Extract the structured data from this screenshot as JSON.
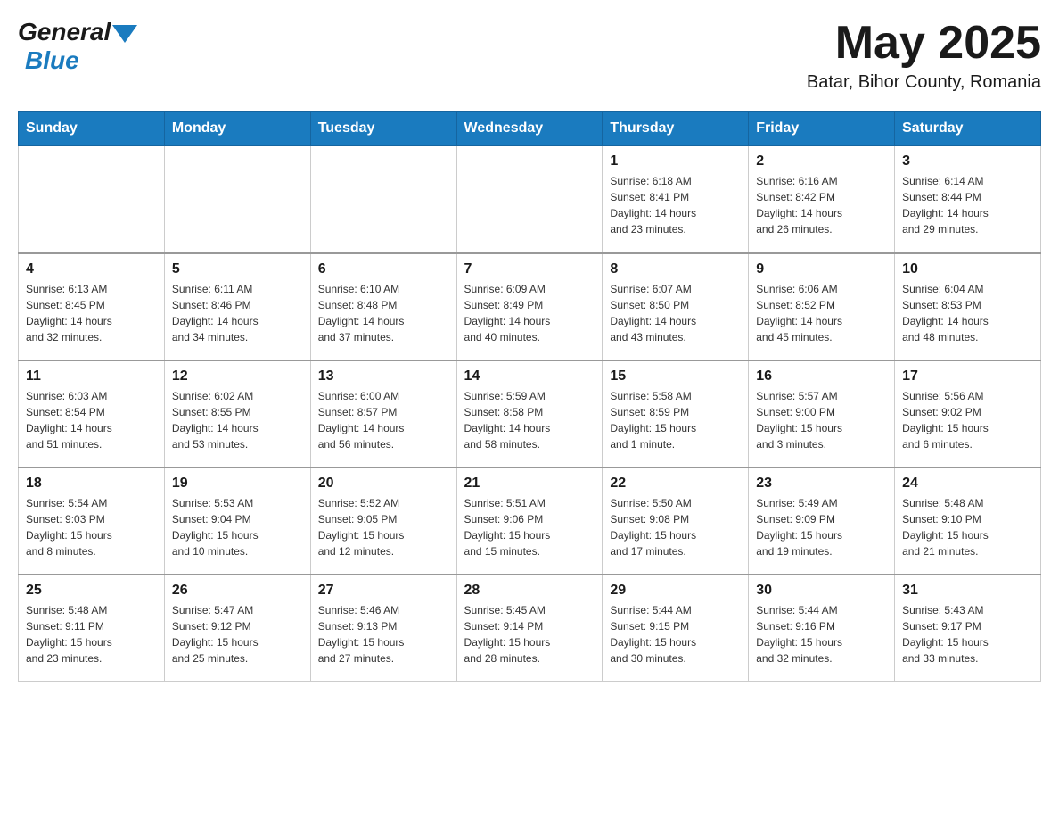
{
  "logo": {
    "general": "General",
    "blue": "Blue"
  },
  "header": {
    "month_title": "May 2025",
    "location": "Batar, Bihor County, Romania"
  },
  "days_of_week": [
    "Sunday",
    "Monday",
    "Tuesday",
    "Wednesday",
    "Thursday",
    "Friday",
    "Saturday"
  ],
  "weeks": [
    [
      {
        "day": "",
        "info": ""
      },
      {
        "day": "",
        "info": ""
      },
      {
        "day": "",
        "info": ""
      },
      {
        "day": "",
        "info": ""
      },
      {
        "day": "1",
        "info": "Sunrise: 6:18 AM\nSunset: 8:41 PM\nDaylight: 14 hours\nand 23 minutes."
      },
      {
        "day": "2",
        "info": "Sunrise: 6:16 AM\nSunset: 8:42 PM\nDaylight: 14 hours\nand 26 minutes."
      },
      {
        "day": "3",
        "info": "Sunrise: 6:14 AM\nSunset: 8:44 PM\nDaylight: 14 hours\nand 29 minutes."
      }
    ],
    [
      {
        "day": "4",
        "info": "Sunrise: 6:13 AM\nSunset: 8:45 PM\nDaylight: 14 hours\nand 32 minutes."
      },
      {
        "day": "5",
        "info": "Sunrise: 6:11 AM\nSunset: 8:46 PM\nDaylight: 14 hours\nand 34 minutes."
      },
      {
        "day": "6",
        "info": "Sunrise: 6:10 AM\nSunset: 8:48 PM\nDaylight: 14 hours\nand 37 minutes."
      },
      {
        "day": "7",
        "info": "Sunrise: 6:09 AM\nSunset: 8:49 PM\nDaylight: 14 hours\nand 40 minutes."
      },
      {
        "day": "8",
        "info": "Sunrise: 6:07 AM\nSunset: 8:50 PM\nDaylight: 14 hours\nand 43 minutes."
      },
      {
        "day": "9",
        "info": "Sunrise: 6:06 AM\nSunset: 8:52 PM\nDaylight: 14 hours\nand 45 minutes."
      },
      {
        "day": "10",
        "info": "Sunrise: 6:04 AM\nSunset: 8:53 PM\nDaylight: 14 hours\nand 48 minutes."
      }
    ],
    [
      {
        "day": "11",
        "info": "Sunrise: 6:03 AM\nSunset: 8:54 PM\nDaylight: 14 hours\nand 51 minutes."
      },
      {
        "day": "12",
        "info": "Sunrise: 6:02 AM\nSunset: 8:55 PM\nDaylight: 14 hours\nand 53 minutes."
      },
      {
        "day": "13",
        "info": "Sunrise: 6:00 AM\nSunset: 8:57 PM\nDaylight: 14 hours\nand 56 minutes."
      },
      {
        "day": "14",
        "info": "Sunrise: 5:59 AM\nSunset: 8:58 PM\nDaylight: 14 hours\nand 58 minutes."
      },
      {
        "day": "15",
        "info": "Sunrise: 5:58 AM\nSunset: 8:59 PM\nDaylight: 15 hours\nand 1 minute."
      },
      {
        "day": "16",
        "info": "Sunrise: 5:57 AM\nSunset: 9:00 PM\nDaylight: 15 hours\nand 3 minutes."
      },
      {
        "day": "17",
        "info": "Sunrise: 5:56 AM\nSunset: 9:02 PM\nDaylight: 15 hours\nand 6 minutes."
      }
    ],
    [
      {
        "day": "18",
        "info": "Sunrise: 5:54 AM\nSunset: 9:03 PM\nDaylight: 15 hours\nand 8 minutes."
      },
      {
        "day": "19",
        "info": "Sunrise: 5:53 AM\nSunset: 9:04 PM\nDaylight: 15 hours\nand 10 minutes."
      },
      {
        "day": "20",
        "info": "Sunrise: 5:52 AM\nSunset: 9:05 PM\nDaylight: 15 hours\nand 12 minutes."
      },
      {
        "day": "21",
        "info": "Sunrise: 5:51 AM\nSunset: 9:06 PM\nDaylight: 15 hours\nand 15 minutes."
      },
      {
        "day": "22",
        "info": "Sunrise: 5:50 AM\nSunset: 9:08 PM\nDaylight: 15 hours\nand 17 minutes."
      },
      {
        "day": "23",
        "info": "Sunrise: 5:49 AM\nSunset: 9:09 PM\nDaylight: 15 hours\nand 19 minutes."
      },
      {
        "day": "24",
        "info": "Sunrise: 5:48 AM\nSunset: 9:10 PM\nDaylight: 15 hours\nand 21 minutes."
      }
    ],
    [
      {
        "day": "25",
        "info": "Sunrise: 5:48 AM\nSunset: 9:11 PM\nDaylight: 15 hours\nand 23 minutes."
      },
      {
        "day": "26",
        "info": "Sunrise: 5:47 AM\nSunset: 9:12 PM\nDaylight: 15 hours\nand 25 minutes."
      },
      {
        "day": "27",
        "info": "Sunrise: 5:46 AM\nSunset: 9:13 PM\nDaylight: 15 hours\nand 27 minutes."
      },
      {
        "day": "28",
        "info": "Sunrise: 5:45 AM\nSunset: 9:14 PM\nDaylight: 15 hours\nand 28 minutes."
      },
      {
        "day": "29",
        "info": "Sunrise: 5:44 AM\nSunset: 9:15 PM\nDaylight: 15 hours\nand 30 minutes."
      },
      {
        "day": "30",
        "info": "Sunrise: 5:44 AM\nSunset: 9:16 PM\nDaylight: 15 hours\nand 32 minutes."
      },
      {
        "day": "31",
        "info": "Sunrise: 5:43 AM\nSunset: 9:17 PM\nDaylight: 15 hours\nand 33 minutes."
      }
    ]
  ]
}
